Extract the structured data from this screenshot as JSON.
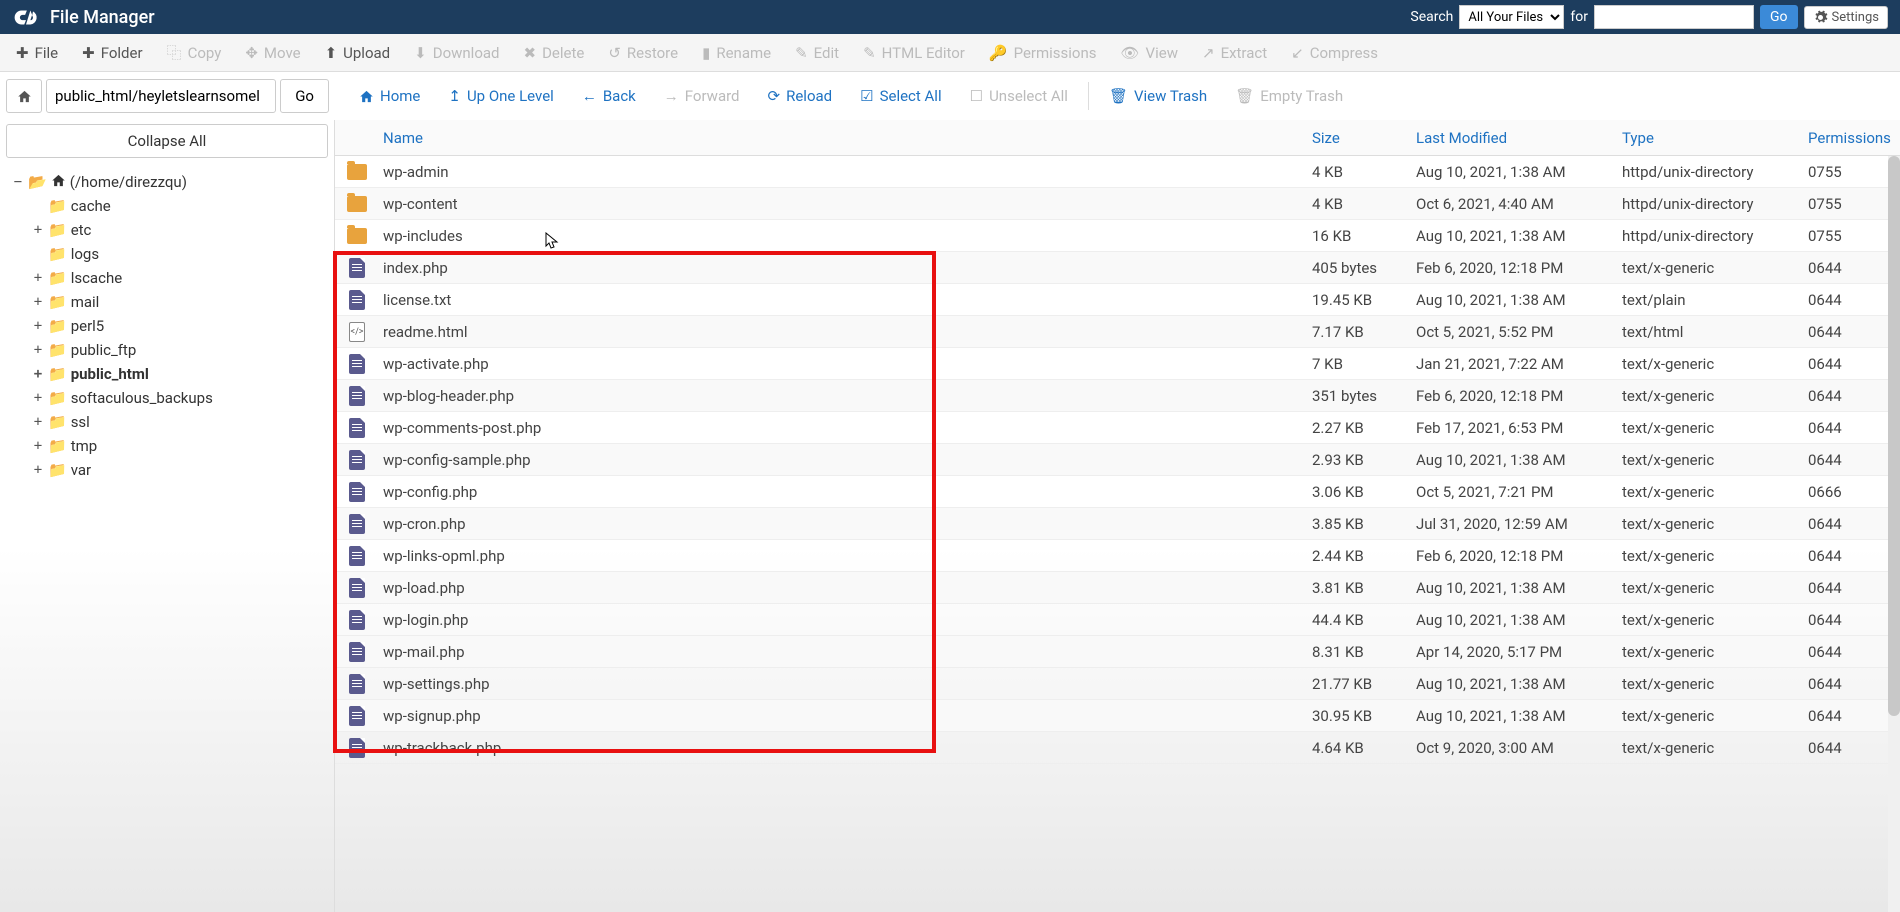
{
  "header": {
    "title": "File Manager",
    "search_label": "Search",
    "search_select": "All Your Files",
    "for_label": "for",
    "for_value": "",
    "go": "Go",
    "settings": "Settings"
  },
  "toolbar": {
    "file": "File",
    "folder": "Folder",
    "copy": "Copy",
    "move": "Move",
    "upload": "Upload",
    "download": "Download",
    "delete": "Delete",
    "restore": "Restore",
    "rename": "Rename",
    "edit": "Edit",
    "html_editor": "HTML Editor",
    "permissions": "Permissions",
    "view": "View",
    "extract": "Extract",
    "compress": "Compress"
  },
  "path": {
    "value": "public_html/heyletslearnsomel",
    "go": "Go"
  },
  "nav": {
    "home": "Home",
    "up": "Up One Level",
    "back": "Back",
    "forward": "Forward",
    "reload": "Reload",
    "select_all": "Select All",
    "unselect_all": "Unselect All",
    "view_trash": "View Trash",
    "empty_trash": "Empty Trash"
  },
  "sidebar": {
    "collapse_all": "Collapse All",
    "root": "(/home/direzzqu)",
    "items": [
      {
        "name": "cache",
        "expandable": false
      },
      {
        "name": "etc",
        "expandable": true
      },
      {
        "name": "logs",
        "expandable": false
      },
      {
        "name": "lscache",
        "expandable": true
      },
      {
        "name": "mail",
        "expandable": true
      },
      {
        "name": "perl5",
        "expandable": true
      },
      {
        "name": "public_ftp",
        "expandable": true
      },
      {
        "name": "public_html",
        "expandable": true,
        "bold": true
      },
      {
        "name": "softaculous_backups",
        "expandable": true
      },
      {
        "name": "ssl",
        "expandable": true
      },
      {
        "name": "tmp",
        "expandable": true
      },
      {
        "name": "var",
        "expandable": true
      }
    ]
  },
  "columns": {
    "name": "Name",
    "size": "Size",
    "modified": "Last Modified",
    "type": "Type",
    "perm": "Permissions"
  },
  "files": [
    {
      "kind": "folder",
      "name": "wp-admin",
      "size": "4 KB",
      "modified": "Aug 10, 2021, 1:38 AM",
      "type": "httpd/unix-directory",
      "perm": "0755"
    },
    {
      "kind": "folder",
      "name": "wp-content",
      "size": "4 KB",
      "modified": "Oct 6, 2021, 4:40 AM",
      "type": "httpd/unix-directory",
      "perm": "0755"
    },
    {
      "kind": "folder",
      "name": "wp-includes",
      "size": "16 KB",
      "modified": "Aug 10, 2021, 1:38 AM",
      "type": "httpd/unix-directory",
      "perm": "0755"
    },
    {
      "kind": "file",
      "name": "index.php",
      "size": "405 bytes",
      "modified": "Feb 6, 2020, 12:18 PM",
      "type": "text/x-generic",
      "perm": "0644"
    },
    {
      "kind": "file",
      "name": "license.txt",
      "size": "19.45 KB",
      "modified": "Aug 10, 2021, 1:38 AM",
      "type": "text/plain",
      "perm": "0644"
    },
    {
      "kind": "html",
      "name": "readme.html",
      "size": "7.17 KB",
      "modified": "Oct 5, 2021, 5:52 PM",
      "type": "text/html",
      "perm": "0644"
    },
    {
      "kind": "file",
      "name": "wp-activate.php",
      "size": "7 KB",
      "modified": "Jan 21, 2021, 7:22 AM",
      "type": "text/x-generic",
      "perm": "0644"
    },
    {
      "kind": "file",
      "name": "wp-blog-header.php",
      "size": "351 bytes",
      "modified": "Feb 6, 2020, 12:18 PM",
      "type": "text/x-generic",
      "perm": "0644"
    },
    {
      "kind": "file",
      "name": "wp-comments-post.php",
      "size": "2.27 KB",
      "modified": "Feb 17, 2021, 6:53 PM",
      "type": "text/x-generic",
      "perm": "0644"
    },
    {
      "kind": "file",
      "name": "wp-config-sample.php",
      "size": "2.93 KB",
      "modified": "Aug 10, 2021, 1:38 AM",
      "type": "text/x-generic",
      "perm": "0644"
    },
    {
      "kind": "file",
      "name": "wp-config.php",
      "size": "3.06 KB",
      "modified": "Oct 5, 2021, 7:21 PM",
      "type": "text/x-generic",
      "perm": "0666"
    },
    {
      "kind": "file",
      "name": "wp-cron.php",
      "size": "3.85 KB",
      "modified": "Jul 31, 2020, 12:59 AM",
      "type": "text/x-generic",
      "perm": "0644"
    },
    {
      "kind": "file",
      "name": "wp-links-opml.php",
      "size": "2.44 KB",
      "modified": "Feb 6, 2020, 12:18 PM",
      "type": "text/x-generic",
      "perm": "0644"
    },
    {
      "kind": "file",
      "name": "wp-load.php",
      "size": "3.81 KB",
      "modified": "Aug 10, 2021, 1:38 AM",
      "type": "text/x-generic",
      "perm": "0644"
    },
    {
      "kind": "file",
      "name": "wp-login.php",
      "size": "44.4 KB",
      "modified": "Aug 10, 2021, 1:38 AM",
      "type": "text/x-generic",
      "perm": "0644"
    },
    {
      "kind": "file",
      "name": "wp-mail.php",
      "size": "8.31 KB",
      "modified": "Apr 14, 2020, 5:17 PM",
      "type": "text/x-generic",
      "perm": "0644"
    },
    {
      "kind": "file",
      "name": "wp-settings.php",
      "size": "21.77 KB",
      "modified": "Aug 10, 2021, 1:38 AM",
      "type": "text/x-generic",
      "perm": "0644"
    },
    {
      "kind": "file",
      "name": "wp-signup.php",
      "size": "30.95 KB",
      "modified": "Aug 10, 2021, 1:38 AM",
      "type": "text/x-generic",
      "perm": "0644"
    },
    {
      "kind": "file",
      "name": "wp-trackback.php",
      "size": "4.64 KB",
      "modified": "Oct 9, 2020, 3:00 AM",
      "type": "text/x-generic",
      "perm": "0644"
    }
  ]
}
